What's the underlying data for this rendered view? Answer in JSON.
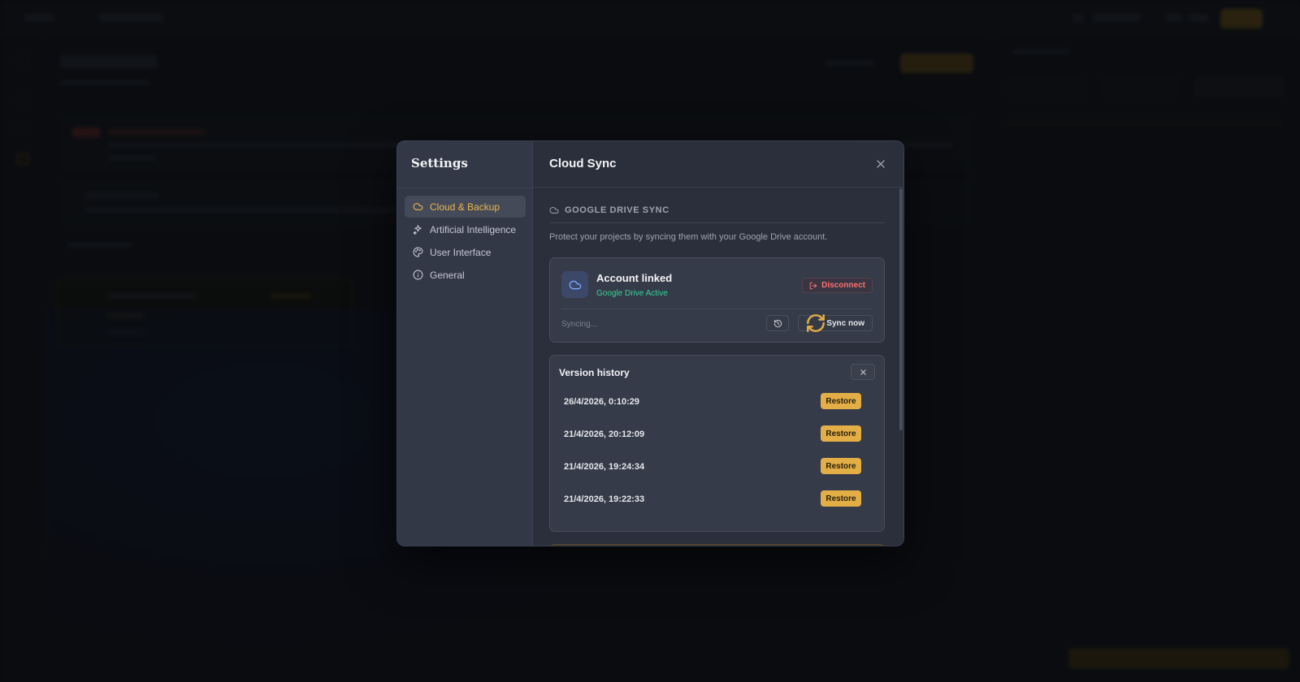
{
  "settings": {
    "title": "Settings",
    "nav": [
      {
        "label": "Cloud & Backup",
        "icon": "cloud-icon",
        "active": true
      },
      {
        "label": "Artificial Intelligence",
        "icon": "sparkles-icon",
        "active": false
      },
      {
        "label": "User Interface",
        "icon": "palette-icon",
        "active": false
      },
      {
        "label": "General",
        "icon": "info-icon",
        "active": false
      }
    ]
  },
  "panel": {
    "title": "Cloud Sync",
    "section_heading": "GOOGLE DRIVE SYNC",
    "description": "Protect your projects by syncing them with your Google Drive account.",
    "account": {
      "title": "Account linked",
      "status": "Google Drive Active",
      "disconnect_label": "Disconnect",
      "sync_status": "Syncing...",
      "sync_now_label": "Sync now"
    },
    "version_history": {
      "title": "Version history",
      "restore_label": "Restore",
      "entries": [
        "26/4/2026, 0:10:29",
        "21/4/2026, 20:12:09",
        "21/4/2026, 19:24:34",
        "21/4/2026, 19:22:33"
      ]
    }
  },
  "colors": {
    "accent": "#e3ae45",
    "success": "#34d399",
    "danger": "#f87171",
    "modal_bg": "#2b2f3b"
  }
}
